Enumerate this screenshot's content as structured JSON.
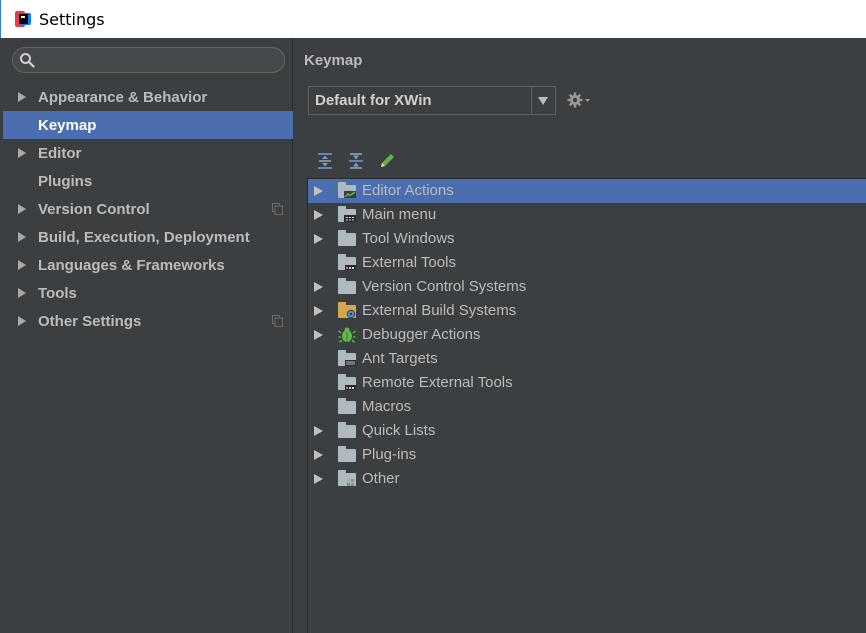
{
  "window": {
    "title": "Settings"
  },
  "colors": {
    "selection": "#4b6eaf",
    "background": "#3c3f41",
    "text": "#bbbbbb"
  },
  "sidebar": {
    "search": {
      "placeholder": "",
      "value": ""
    },
    "items": [
      {
        "label": "Appearance & Behavior",
        "expandable": true,
        "selected": false,
        "has_copy_icon": false
      },
      {
        "label": "Keymap",
        "expandable": false,
        "selected": true,
        "has_copy_icon": false
      },
      {
        "label": "Editor",
        "expandable": true,
        "selected": false,
        "has_copy_icon": false
      },
      {
        "label": "Plugins",
        "expandable": false,
        "selected": false,
        "has_copy_icon": false
      },
      {
        "label": "Version Control",
        "expandable": true,
        "selected": false,
        "has_copy_icon": true
      },
      {
        "label": "Build, Execution, Deployment",
        "expandable": true,
        "selected": false,
        "has_copy_icon": false
      },
      {
        "label": "Languages & Frameworks",
        "expandable": true,
        "selected": false,
        "has_copy_icon": false
      },
      {
        "label": "Tools",
        "expandable": true,
        "selected": false,
        "has_copy_icon": false
      },
      {
        "label": "Other Settings",
        "expandable": true,
        "selected": false,
        "has_copy_icon": true
      }
    ]
  },
  "main": {
    "title": "Keymap",
    "keymap_select": {
      "value": "Default for XWin"
    },
    "toolbar": {
      "buttons": [
        {
          "icon": "expand-all-icon"
        },
        {
          "icon": "collapse-all-icon"
        },
        {
          "icon": "edit-pencil-icon"
        }
      ]
    },
    "tree": [
      {
        "label": "Editor Actions",
        "expandable": true,
        "selected": true,
        "icon": "editor-actions-folder-icon"
      },
      {
        "label": "Main menu",
        "expandable": true,
        "selected": false,
        "icon": "main-menu-folder-icon"
      },
      {
        "label": "Tool Windows",
        "expandable": true,
        "selected": false,
        "icon": "folder-icon"
      },
      {
        "label": "External Tools",
        "expandable": false,
        "selected": false,
        "icon": "external-tools-folder-icon"
      },
      {
        "label": "Version Control Systems",
        "expandable": true,
        "selected": false,
        "icon": "folder-icon"
      },
      {
        "label": "External Build Systems",
        "expandable": true,
        "selected": false,
        "icon": "build-systems-folder-icon"
      },
      {
        "label": "Debugger Actions",
        "expandable": true,
        "selected": false,
        "icon": "bug-icon"
      },
      {
        "label": "Ant Targets",
        "expandable": false,
        "selected": false,
        "icon": "ant-targets-folder-icon"
      },
      {
        "label": "Remote External Tools",
        "expandable": false,
        "selected": false,
        "icon": "remote-tools-folder-icon"
      },
      {
        "label": "Macros",
        "expandable": false,
        "selected": false,
        "icon": "folder-icon"
      },
      {
        "label": "Quick Lists",
        "expandable": true,
        "selected": false,
        "icon": "folder-icon"
      },
      {
        "label": "Plug-ins",
        "expandable": true,
        "selected": false,
        "icon": "folder-icon"
      },
      {
        "label": "Other",
        "expandable": true,
        "selected": false,
        "icon": "other-folder-icon"
      }
    ]
  }
}
